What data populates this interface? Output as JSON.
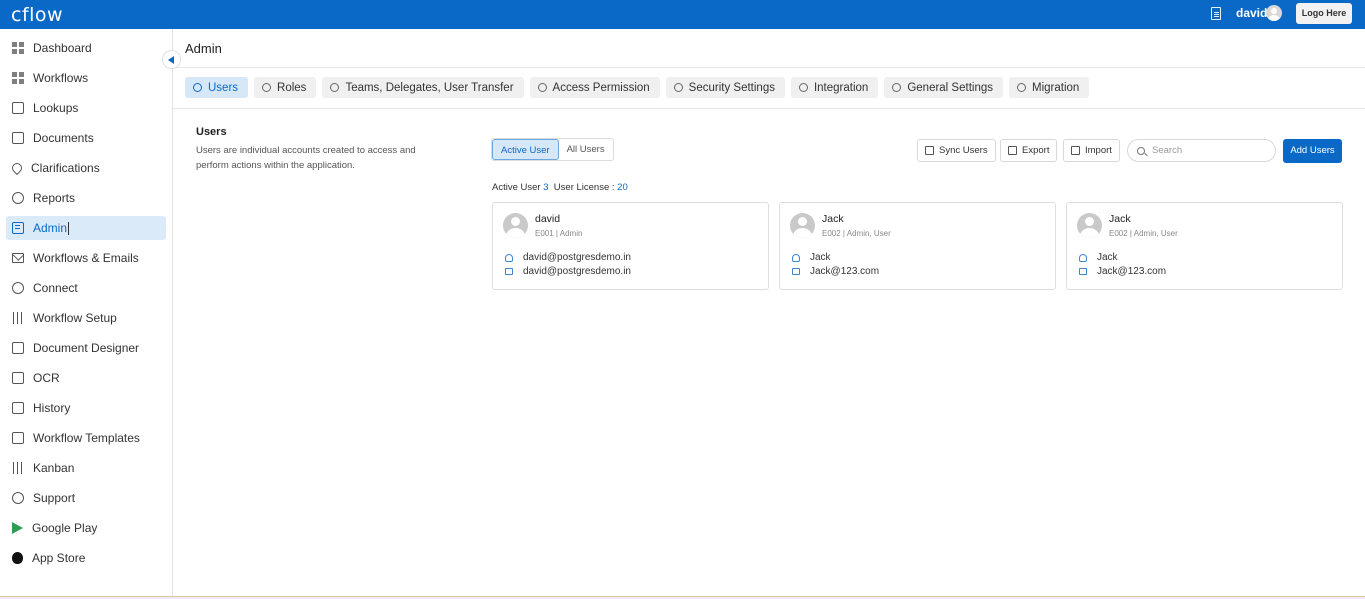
{
  "app": {
    "logo": "cflow",
    "user_name": "david",
    "logo_placeholder": "Logo Here"
  },
  "sidebar": {
    "items": [
      {
        "label": "Dashboard",
        "icon": "dashboard-icon"
      },
      {
        "label": "Workflows",
        "icon": "workflows-icon"
      },
      {
        "label": "Lookups",
        "icon": "lookups-icon"
      },
      {
        "label": "Documents",
        "icon": "documents-icon"
      },
      {
        "label": "Clarifications",
        "icon": "clarifications-icon"
      },
      {
        "label": "Reports",
        "icon": "reports-icon"
      },
      {
        "label": "Admin",
        "icon": "admin-icon",
        "active": true
      },
      {
        "label": "Workflows & Emails",
        "icon": "mail-icon"
      },
      {
        "label": "Connect",
        "icon": "connect-icon"
      },
      {
        "label": "Workflow Setup",
        "icon": "sliders-icon"
      },
      {
        "label": "Document Designer",
        "icon": "document-designer-icon"
      },
      {
        "label": "OCR",
        "icon": "ocr-icon"
      },
      {
        "label": "History",
        "icon": "history-icon"
      },
      {
        "label": "Workflow Templates",
        "icon": "templates-icon"
      },
      {
        "label": "Kanban",
        "icon": "kanban-icon"
      },
      {
        "label": "Support",
        "icon": "support-icon"
      },
      {
        "label": "Google Play",
        "icon": "google-play-icon"
      },
      {
        "label": "App Store",
        "icon": "apple-icon"
      }
    ]
  },
  "main": {
    "title": "Admin",
    "tabs": [
      {
        "label": "Users",
        "active": true
      },
      {
        "label": "Roles"
      },
      {
        "label": "Teams, Delegates, User Transfer"
      },
      {
        "label": "Access Permission"
      },
      {
        "label": "Security Settings"
      },
      {
        "label": "Integration"
      },
      {
        "label": "General Settings"
      },
      {
        "label": "Migration"
      }
    ],
    "section": {
      "title": "Users",
      "description": "Users are individual accounts created to access and perform actions within the application."
    },
    "toggle": {
      "active_user": "Active User",
      "all_users": "All Users"
    },
    "actions": {
      "sync": "Sync Users",
      "export": "Export",
      "import": "Import",
      "search_placeholder": "Search",
      "add": "Add Users"
    },
    "counts": {
      "active_label": "Active User",
      "active_value": "3",
      "license_label": "User License :",
      "license_value": "20"
    },
    "cards": [
      {
        "name": "david",
        "sub": "E001 | Admin",
        "username": "david@postgresdemo.in",
        "email": "david@postgresdemo.in"
      },
      {
        "name": "Jack",
        "sub": "E002 | Admin, User",
        "username": "Jack",
        "email": "Jack@123.com"
      },
      {
        "name": "Jack",
        "sub": "E002 | Admin, User",
        "username": "Jack",
        "email": "Jack@123.com"
      }
    ]
  },
  "colors": {
    "brand": "#0a69c7",
    "active_bg": "#dbeaf8"
  }
}
